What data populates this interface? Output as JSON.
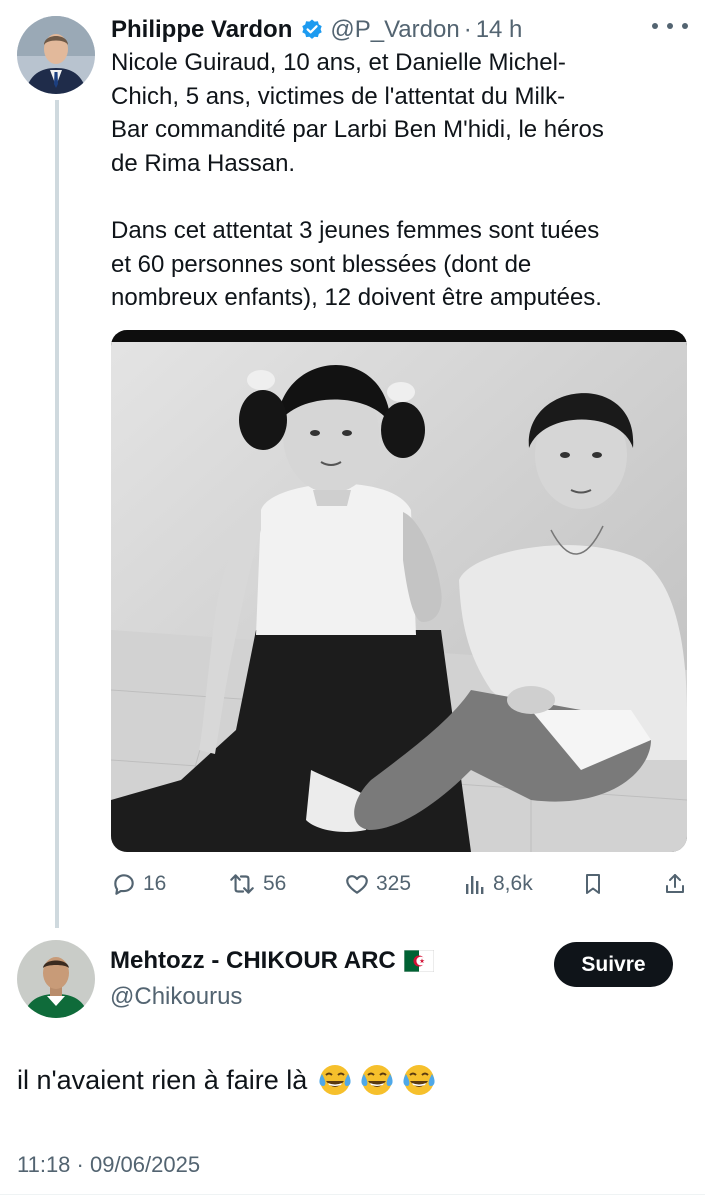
{
  "parent_tweet": {
    "display_name": "Philippe Vardon",
    "handle": "@P_Vardon",
    "separator": "·",
    "time": "14 h",
    "text": "Nicole Guiraud, 10 ans, et Danielle Michel-\nChich, 5 ans, victimes de l'attentat du Milk-\nBar commandité par Larbi Ben M'hidi, le héros\nde Rima Hassan.\n\nDans cet attentat 3 jeunes femmes sont tuées\net 60 personnes sont blessées (dont de\nnombreux enfants), 12 doivent être amputées.",
    "media": {
      "description": "black-and-white photo",
      "colors": {
        "tone_light": "#d9d9d9",
        "tone_dark": "#1e1e1e"
      }
    },
    "actions": {
      "replies": "16",
      "reposts": "56",
      "likes": "325",
      "views": "8,6k"
    }
  },
  "reply_tweet": {
    "display_name": "Mehtozz - CHIKOUR ARC",
    "flag_icon": "algeria-flag-icon",
    "handle": "@Chikourus",
    "follow_label": "Suivre",
    "text": "il n'avaient rien à faire là",
    "emojis": [
      "face-with-tears-of-joy",
      "face-with-tears-of-joy",
      "face-with-tears-of-joy"
    ],
    "timestamp": "11:18 · 09/06/2025"
  },
  "colors": {
    "text_primary": "#0f1419",
    "text_secondary": "#536471",
    "verified": "#1d9bf0",
    "thread_line": "#cfd9de",
    "follow_bg": "#0f1419"
  }
}
